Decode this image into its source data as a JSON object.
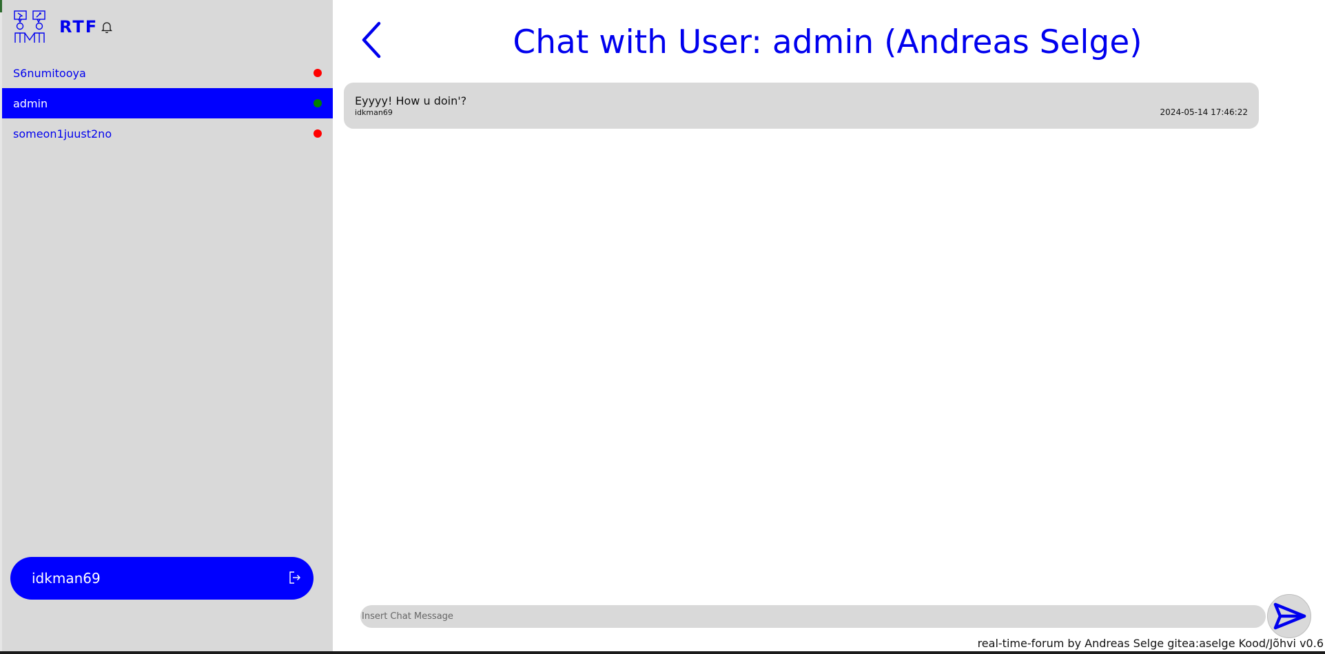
{
  "app": {
    "brand": "RTF",
    "accent_color": "#0000ff",
    "sidebar_bg": "#d9d9d9"
  },
  "sidebar": {
    "users": [
      {
        "name": "S6numitooya",
        "status": "offline",
        "status_color": "#ff0000",
        "active": false
      },
      {
        "name": "admin",
        "status": "online",
        "status_color": "#008000",
        "active": true
      },
      {
        "name": "someon1juust2no",
        "status": "offline",
        "status_color": "#ff0000",
        "active": false
      }
    ],
    "current_user": "idkman69"
  },
  "chat": {
    "title": "Chat with User: admin (Andreas Selge)",
    "messages": [
      {
        "text": "Eyyyy! How u doin'?",
        "author": "idkman69",
        "timestamp": "2024-05-14 17:46:22"
      }
    ],
    "input_placeholder": "Insert Chat Message"
  },
  "footer": {
    "text": "real-time-forum by Andreas Selge gitea:aselge Kood/Jõhvi v0.6"
  },
  "icons": {
    "logo": "rtf-logo-icon",
    "notifications": "bell-icon",
    "back": "chevron-left-icon",
    "logout": "logout-icon",
    "send": "send-icon"
  }
}
